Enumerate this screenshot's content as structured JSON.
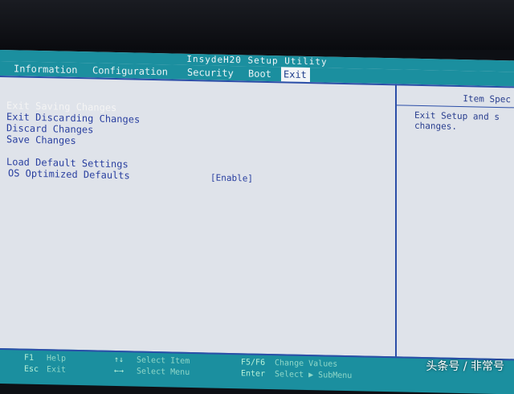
{
  "title": "InsydeH20 Setup Utility",
  "menu": {
    "items": [
      "Information",
      "Configuration",
      "Security",
      "Boot",
      "Exit"
    ],
    "active_index": 4
  },
  "options": [
    {
      "label": "Exit Saving Changes",
      "selected": true
    },
    {
      "label": "Exit Discarding Changes",
      "selected": false
    },
    {
      "label": "Discard Changes",
      "selected": false
    },
    {
      "label": "Save Changes",
      "selected": false
    },
    {
      "label": "Load Default Settings",
      "selected": false
    },
    {
      "label": "OS Optimized Defaults",
      "selected": false,
      "value": "[Enable]"
    }
  ],
  "help": {
    "heading": "Item Spec",
    "text": "Exit Setup and s changes."
  },
  "footer": {
    "keys": [
      {
        "key": "F1",
        "desc": "Help"
      },
      {
        "key": "Esc",
        "desc": "Exit"
      },
      {
        "key": "↑↓",
        "desc": "Select Item"
      },
      {
        "key": "←→",
        "desc": "Select Menu"
      },
      {
        "key": "F5/F6",
        "desc": "Change Values"
      },
      {
        "key": "Enter",
        "desc": "Select ▶ SubMenu"
      }
    ]
  },
  "watermark": "头条号 / 非常号",
  "colors": {
    "accent": "#1b8f9f",
    "panel": "#dfe3ea",
    "option_text": "#2a40a0",
    "border": "#2b4ea8"
  }
}
